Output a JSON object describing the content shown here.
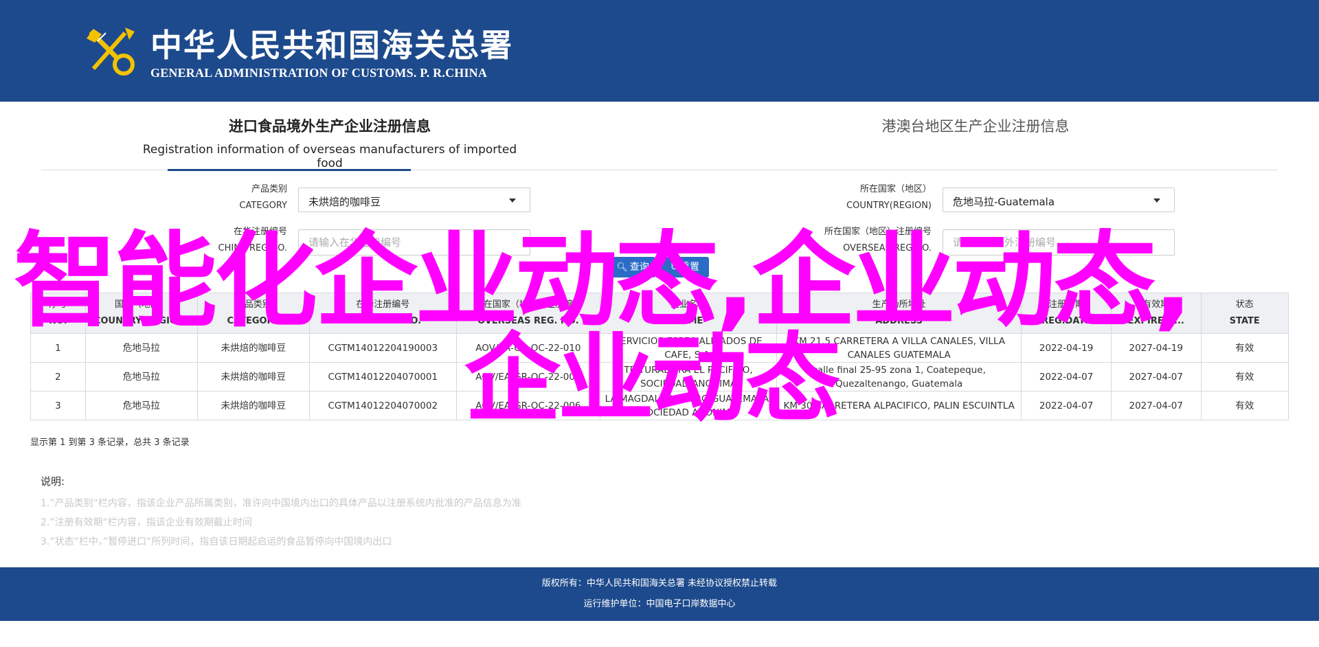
{
  "header": {
    "title_cn": "中华人民共和国海关总署",
    "title_en": "GENERAL ADMINISTRATION OF CUSTOMS. P. R.CHINA",
    "emblem_icon": "customs-emblem-icon"
  },
  "tabs": [
    {
      "label_cn": "进口食品境外生产企业注册信息",
      "label_en": "Registration information of overseas manufacturers of imported food",
      "active": true
    },
    {
      "label_cn": "港澳台地区生产企业注册信息",
      "active": false
    }
  ],
  "filters": {
    "category": {
      "label_cn": "产品类别",
      "label_en": "CATEGORY",
      "value": "未烘焙的咖啡豆"
    },
    "country": {
      "label_cn": "所在国家（地区）",
      "label_en": "COUNTRY(REGION)",
      "value": "危地马拉-Guatemala"
    },
    "reg_no_cn": {
      "label_cn": "在华注册编号",
      "label_en": "CHINA REG.NO.",
      "placeholder": "请输入在华注册编号"
    },
    "reg_no_overseas": {
      "label_cn": "所在国家（地区）注册编号",
      "label_en": "OVERSEAS REG.NO.",
      "placeholder": "请输入在国外注册编号"
    }
  },
  "buttons": {
    "search": "查询",
    "reset": "重置"
  },
  "table": {
    "columns": [
      {
        "cn": "序号",
        "en": "NO."
      },
      {
        "cn": "国家（地区）",
        "en": "COUNTRY(REGION)"
      },
      {
        "cn": "产品类别",
        "en": "CATEGORY"
      },
      {
        "cn": "在华注册编号",
        "en": "CHINA REG.NO."
      },
      {
        "cn": "所在国家（地区）注册编号",
        "en": "OVERSEAS REG. NO."
      },
      {
        "cn": "企业名称",
        "en": "NAME"
      },
      {
        "cn": "生产场所地址",
        "en": "ADDRESS"
      },
      {
        "cn": "注册日期",
        "en": "REG.DATE"
      },
      {
        "cn": "有效期",
        "en": "EXPIRE D..."
      },
      {
        "cn": "状态",
        "en": "STATE"
      }
    ],
    "rows": [
      [
        "1",
        "危地马拉",
        "未烘焙的咖啡豆",
        "CGTM14012204190003",
        "AOV/EA-GR-OC-22-010",
        "SERVICIOS ESPECIALIZADOS DE CAFE, S.A.",
        "KM 21.5 CARRETERA A VILLA CANALES, VILLA CANALES GUATEMALA",
        "2022-04-19",
        "2027-04-19",
        "有效"
      ],
      [
        "2",
        "危地马拉",
        "未烘焙的咖啡豆",
        "CGTM14012204070001",
        "AOV/EA-GR-OC-22-002",
        "TRITURADORA EL PACIFICO, SOCIEDAD ANONIMA",
        "calle final 25-95 zona 1, Coatepeque, Quezaltenango, Guatemala",
        "2022-04-07",
        "2027-04-07",
        "有效"
      ],
      [
        "3",
        "危地马拉",
        "未烘焙的咖啡豆",
        "CGTM14012204070002",
        "AOV/EA-GR-OC-22-006",
        "LA MAGDALENA AGRO GUATEMALA, SOCIEDAD ANONIMA",
        "KM 30 CARRETERA ALPACIFICO, PALIN ESCUINTLA",
        "2022-04-07",
        "2027-04-07",
        "有效"
      ]
    ]
  },
  "summary": "显示第 1 到第 3 条记录，总共 3 条记录",
  "notes": {
    "title": "说明:",
    "lines": [
      "1.”产品类别“栏内容，指该企业产品所属类别，准许向中国境内出口的具体产品以注册系统内批准的产品信息为准",
      "2.”注册有效期“栏内容，指该企业有效期截止时间",
      "3.”状态“栏中，”暂停进口“所列时间，指自该日期起启运的食品暂停向中国境内出口"
    ]
  },
  "footer": {
    "line1": "版权所有：中华人民共和国海关总署 未经协议授权禁止转载",
    "line2": "运行维护单位：中国电子口岸数据中心"
  },
  "overlay": {
    "line1": "智能化企业动态,企业动态,",
    "line2": "企业动态"
  },
  "colors": {
    "header_bg": "#1d4a8c",
    "button_bg": "#2a6cc6",
    "overlay": "#ff00ff"
  }
}
